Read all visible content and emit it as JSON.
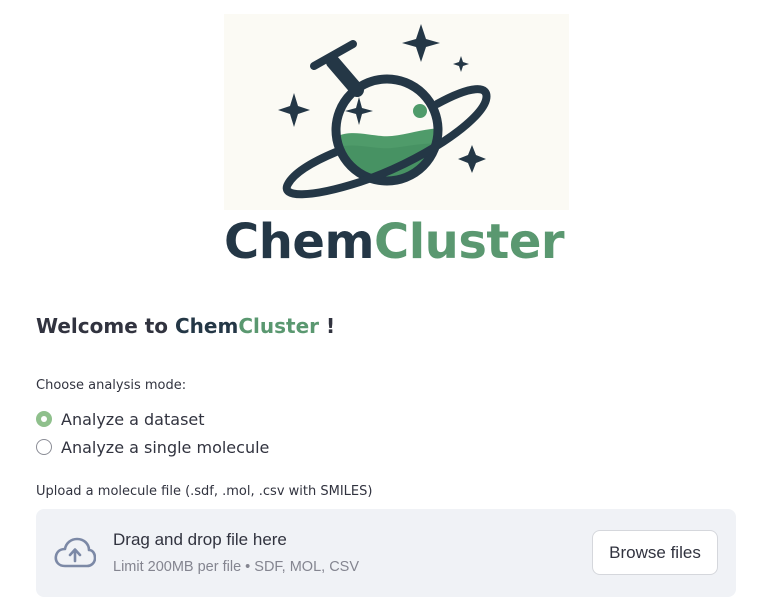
{
  "logo": {
    "wordmark_part1": "Chem",
    "wordmark_part2": "Cluster",
    "colors": {
      "dark": "#243746",
      "green": "#5a9870",
      "liquid": "#4f9b6a"
    }
  },
  "welcome": {
    "prefix": "Welcome to ",
    "brand_part1": "Chem",
    "brand_part2": "Cluster",
    "suffix": " !"
  },
  "mode": {
    "label": "Choose analysis mode:",
    "options": [
      {
        "label": "Analyze a dataset",
        "selected": true
      },
      {
        "label": "Analyze a single molecule",
        "selected": false
      }
    ]
  },
  "upload": {
    "label": "Upload a molecule file (.sdf, .mol, .csv with SMILES)",
    "drop_title": "Drag and drop file here",
    "drop_subtitle": "Limit 200MB per file • SDF, MOL, CSV",
    "browse_label": "Browse files",
    "icon": "cloud-upload-icon"
  }
}
